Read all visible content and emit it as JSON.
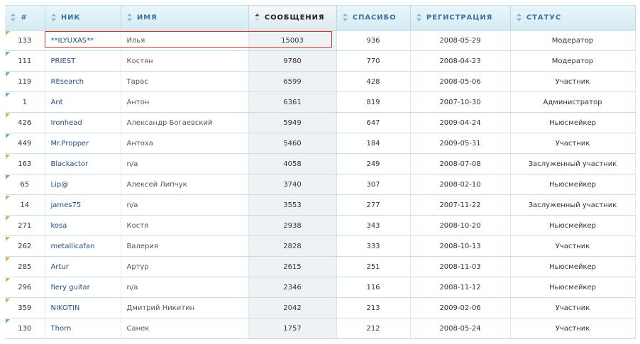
{
  "columns": [
    {
      "key": "num",
      "label": "#"
    },
    {
      "key": "nick",
      "label": "НИК"
    },
    {
      "key": "name",
      "label": "ИМЯ"
    },
    {
      "key": "posts",
      "label": "СООБЩЕНИЯ"
    },
    {
      "key": "thanks",
      "label": "СПАСИБО"
    },
    {
      "key": "reg",
      "label": "РЕГИСТРАЦИЯ"
    },
    {
      "key": "status",
      "label": "СТАТУС"
    }
  ],
  "sorted_column": "posts",
  "rows": [
    {
      "num": "133",
      "nick": "**ILYUXAS**",
      "name": "Илья",
      "posts": "15003",
      "thanks": "936",
      "reg": "2008-05-29",
      "status": "Модератор",
      "flag": "orange"
    },
    {
      "num": "111",
      "nick": "PRIEST",
      "name": "Костян",
      "posts": "9780",
      "thanks": "770",
      "reg": "2008-04-23",
      "status": "Модератор",
      "flag": "blue"
    },
    {
      "num": "119",
      "nick": "REsearch",
      "name": "Тарас",
      "posts": "6599",
      "thanks": "428",
      "reg": "2008-05-06",
      "status": "Участник",
      "flag": "blue"
    },
    {
      "num": "1",
      "nick": "Ant",
      "name": "Антон",
      "posts": "6361",
      "thanks": "819",
      "reg": "2007-10-30",
      "status": "Администратор",
      "flag": "blue"
    },
    {
      "num": "426",
      "nick": "Ironhead",
      "name": "Александр Богаевский",
      "posts": "5949",
      "thanks": "647",
      "reg": "2009-04-24",
      "status": "Ньюсмейкер",
      "flag": "orange"
    },
    {
      "num": "449",
      "nick": "Mr.Propper",
      "name": "Антоха",
      "posts": "5460",
      "thanks": "184",
      "reg": "2009-05-31",
      "status": "Участник",
      "flag": "blue"
    },
    {
      "num": "163",
      "nick": "Blackactor",
      "name": "n/a",
      "posts": "4058",
      "thanks": "249",
      "reg": "2008-07-08",
      "status": "Заслуженный участник",
      "flag": "orange"
    },
    {
      "num": "65",
      "nick": "Lip@",
      "name": "Алексей Липчук",
      "posts": "3740",
      "thanks": "307",
      "reg": "2008-02-10",
      "status": "Ньюсмейкер",
      "flag": "blue"
    },
    {
      "num": "14",
      "nick": "james75",
      "name": "n/a",
      "posts": "3553",
      "thanks": "277",
      "reg": "2007-11-22",
      "status": "Заслуженный участник",
      "flag": "orange"
    },
    {
      "num": "271",
      "nick": "kosa",
      "name": "Костя",
      "posts": "2938",
      "thanks": "343",
      "reg": "2008-10-20",
      "status": "Ньюсмейкер",
      "flag": "orange"
    },
    {
      "num": "262",
      "nick": "metallicafan",
      "name": "Валерия",
      "posts": "2828",
      "thanks": "333",
      "reg": "2008-10-13",
      "status": "Участник",
      "flag": "orange"
    },
    {
      "num": "285",
      "nick": "Artur",
      "name": "Артур",
      "posts": "2615",
      "thanks": "251",
      "reg": "2008-11-03",
      "status": "Ньюсмейкер",
      "flag": "orange"
    },
    {
      "num": "296",
      "nick": "fiery guitar",
      "name": "n/a",
      "posts": "2346",
      "thanks": "116",
      "reg": "2008-11-12",
      "status": "Ньюсмейкер",
      "flag": "orange"
    },
    {
      "num": "359",
      "nick": "NIKOTIN",
      "name": "Дмитрий Никитин",
      "posts": "2042",
      "thanks": "213",
      "reg": "2009-02-06",
      "status": "Участник",
      "flag": "orange"
    },
    {
      "num": "130",
      "nick": "Thorn",
      "name": "Санек",
      "posts": "1757",
      "thanks": "212",
      "reg": "2008-05-24",
      "status": "Участник",
      "flag": "blue"
    }
  ],
  "colors": {
    "header_text": "#3a73a8",
    "nick_link": "#1f4f86",
    "highlight_border": "#c0392b",
    "flag_orange": "#e0a060",
    "flag_blue": "#6aa5d8"
  },
  "icons": {
    "sort": "sort-arrows-icon",
    "row_marker": "corner-flag-icon"
  }
}
